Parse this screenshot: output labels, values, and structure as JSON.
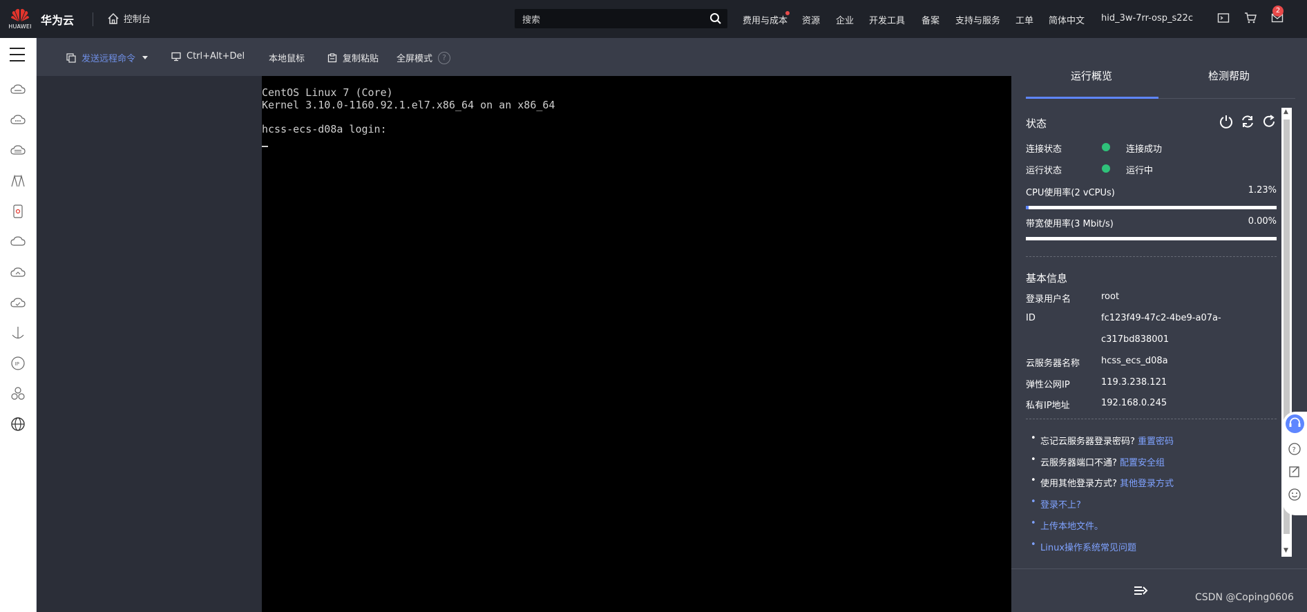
{
  "header": {
    "logo_text": "HUAWEI",
    "brand": "华为云",
    "console": "控制台",
    "search_placeholder": "搜索",
    "nav": [
      "费用与成本",
      "资源",
      "企业",
      "开发工具",
      "备案",
      "支持与服务",
      "工单",
      "简体中文",
      "hid_3w-7rr-osp_s22c"
    ],
    "message_count": "2",
    "icons": [
      "terminal-icon",
      "cart-icon",
      "mail-icon"
    ]
  },
  "sidebar": {
    "icons": [
      "menu-icon",
      "cloud-server-icon",
      "cloud-icon",
      "cloud-db-icon",
      "network-icon",
      "storage-icon",
      "cloud-outline-icon",
      "cloud-home-icon",
      "cloud-check-icon",
      "anchor-icon",
      "ip-icon",
      "cluster-icon",
      "globe-icon"
    ]
  },
  "toolbar": {
    "send_command": "发送远程命令",
    "ctrl_alt_del": "Ctrl+Alt+Del",
    "local_mouse": "本地鼠标",
    "copy_paste": "复制粘贴",
    "fullscreen": "全屏模式",
    "help": "?"
  },
  "terminal": {
    "lines": [
      "CentOS Linux 7 (Core)",
      "Kernel 3.10.0-1160.92.1.el7.x86_64 on an x86_64",
      "",
      "hcss-ecs-d08a login:"
    ]
  },
  "panel": {
    "tabs": [
      "运行概览",
      "检测帮助"
    ],
    "status": {
      "title": "状态",
      "connect_label": "连接状态",
      "connect_value": "连接成功",
      "run_label": "运行状态",
      "run_value": "运行中",
      "cpu_label": "CPU使用率(2 vCPUs)",
      "cpu_value": "1.23%",
      "cpu_fraction": 0.0123,
      "bw_label": "带宽使用率(3 Mbit/s)",
      "bw_value": "0.00%",
      "bw_fraction": 0.0
    },
    "basic": {
      "title": "基本信息",
      "username_label": "登录用户名",
      "username": "root",
      "id_label": "ID",
      "id_line1": "fc123f49-47c2-4be9-a07a-",
      "id_line2": "c317bd838001",
      "name_label": "云服务器名称",
      "name": "hcss_ecs_d08a",
      "eip_label": "弹性公网IP",
      "eip": "119.3.238.121",
      "private_ip_label": "私有IP地址",
      "private_ip": "192.168.0.245"
    },
    "help": {
      "forget_q": "忘记云服务器登录密码?",
      "forget_link": "重置密码",
      "port_q": "云服务器端口不通?",
      "port_link": "配置安全组",
      "other_q": "使用其他登录方式?",
      "other_link": "其他登录方式",
      "cant_login": "登录不上?",
      "upload": "上传本地文件。",
      "faq": "Linux操作系统常见问题"
    }
  },
  "watermark": "CSDN @Coping0606",
  "colors": {
    "accent": "#5e86ff",
    "ok": "#2fc27a",
    "link": "#7fa2ff",
    "topbar": "#1f2229",
    "panel": "#393d49"
  }
}
